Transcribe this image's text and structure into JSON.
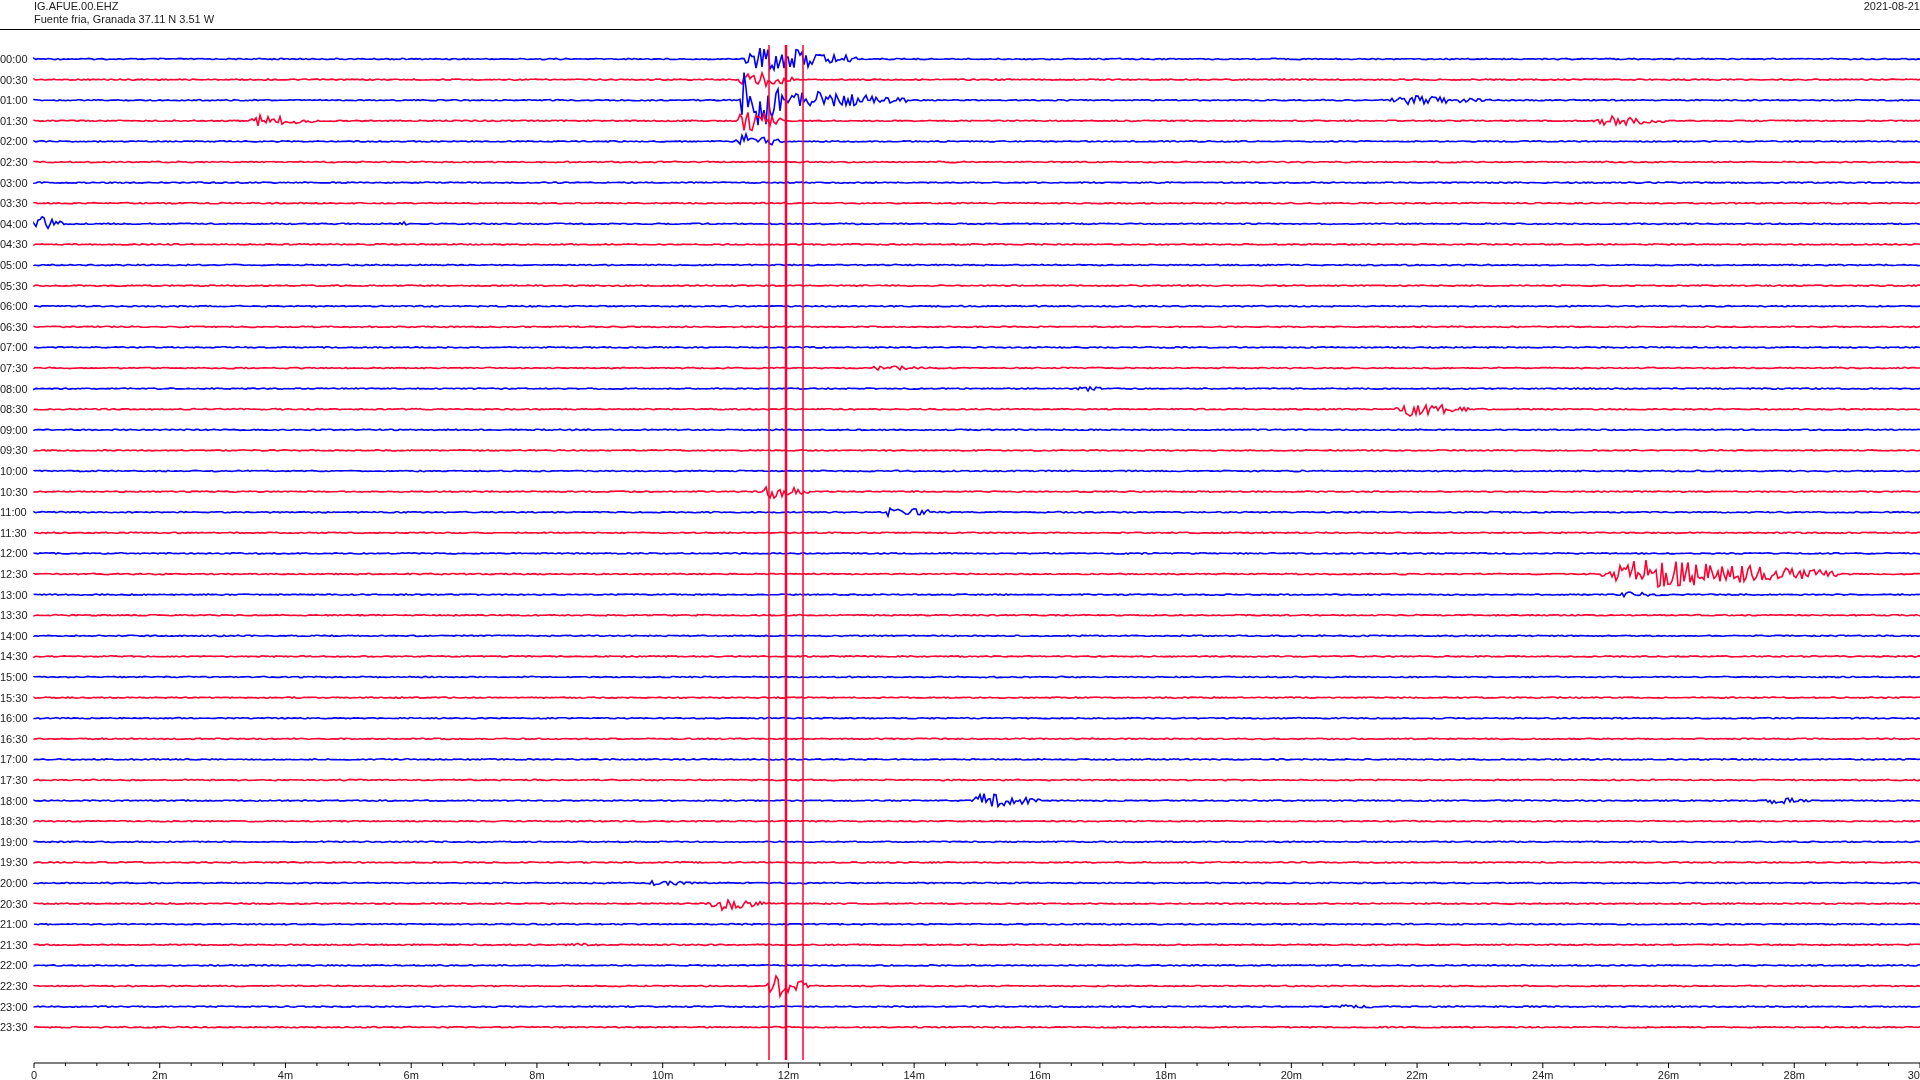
{
  "header": {
    "station": "IG.AFUE.00.EHZ",
    "location": "Fuente fria, Granada  37.11 N 3.51 W",
    "date": "2021-08-21"
  },
  "traces": [
    {
      "label": "00:00",
      "color": "#0000ff"
    },
    {
      "label": "00:30",
      "color": "#ff0030"
    },
    {
      "label": "01:00",
      "color": "#0000ff"
    },
    {
      "label": "01:30",
      "color": "#ff0030"
    },
    {
      "label": "02:00",
      "color": "#0000ff"
    },
    {
      "label": "02:30",
      "color": "#ff0030"
    },
    {
      "label": "03:00",
      "color": "#0000ff"
    },
    {
      "label": "03:30",
      "color": "#ff0030"
    },
    {
      "label": "04:00",
      "color": "#0000ff"
    },
    {
      "label": "04:30",
      "color": "#ff0030"
    },
    {
      "label": "05:00",
      "color": "#0000ff"
    },
    {
      "label": "05:30",
      "color": "#ff0030"
    },
    {
      "label": "06:00",
      "color": "#0000ff"
    },
    {
      "label": "06:30",
      "color": "#ff0030"
    },
    {
      "label": "07:00",
      "color": "#0000ff"
    },
    {
      "label": "07:30",
      "color": "#ff0030"
    },
    {
      "label": "08:00",
      "color": "#0000ff"
    },
    {
      "label": "08:30",
      "color": "#ff0030"
    },
    {
      "label": "09:00",
      "color": "#0000ff"
    },
    {
      "label": "09:30",
      "color": "#ff0030"
    },
    {
      "label": "10:00",
      "color": "#0000ff"
    },
    {
      "label": "10:30",
      "color": "#ff0030"
    },
    {
      "label": "11:00",
      "color": "#0000ff"
    },
    {
      "label": "11:30",
      "color": "#ff0030"
    },
    {
      "label": "12:00",
      "color": "#0000ff"
    },
    {
      "label": "12:30",
      "color": "#ff0030"
    },
    {
      "label": "13:00",
      "color": "#0000ff"
    },
    {
      "label": "13:30",
      "color": "#ff0030"
    },
    {
      "label": "14:00",
      "color": "#0000ff"
    },
    {
      "label": "14:30",
      "color": "#ff0030"
    },
    {
      "label": "15:00",
      "color": "#0000ff"
    },
    {
      "label": "15:30",
      "color": "#ff0030"
    },
    {
      "label": "16:00",
      "color": "#0000ff"
    },
    {
      "label": "16:30",
      "color": "#ff0030"
    },
    {
      "label": "17:00",
      "color": "#0000ff"
    },
    {
      "label": "17:30",
      "color": "#ff0030"
    },
    {
      "label": "18:00",
      "color": "#0000ff"
    },
    {
      "label": "18:30",
      "color": "#ff0030"
    },
    {
      "label": "19:00",
      "color": "#0000ff"
    },
    {
      "label": "19:30",
      "color": "#ff0030"
    },
    {
      "label": "20:00",
      "color": "#0000ff"
    },
    {
      "label": "20:30",
      "color": "#ff0030"
    },
    {
      "label": "21:00",
      "color": "#0000ff"
    },
    {
      "label": "21:30",
      "color": "#ff0030"
    },
    {
      "label": "22:00",
      "color": "#0000ff"
    },
    {
      "label": "22:30",
      "color": "#ff0030"
    },
    {
      "label": "23:00",
      "color": "#0000ff"
    },
    {
      "label": "23:30",
      "color": "#ff0030"
    }
  ],
  "x_axis": {
    "labels": [
      "0",
      "2m",
      "4m",
      "6m",
      "8m",
      "10m",
      "12m",
      "14m",
      "16m",
      "18m",
      "20m",
      "22m",
      "24m",
      "26m",
      "28m",
      "30"
    ]
  }
}
